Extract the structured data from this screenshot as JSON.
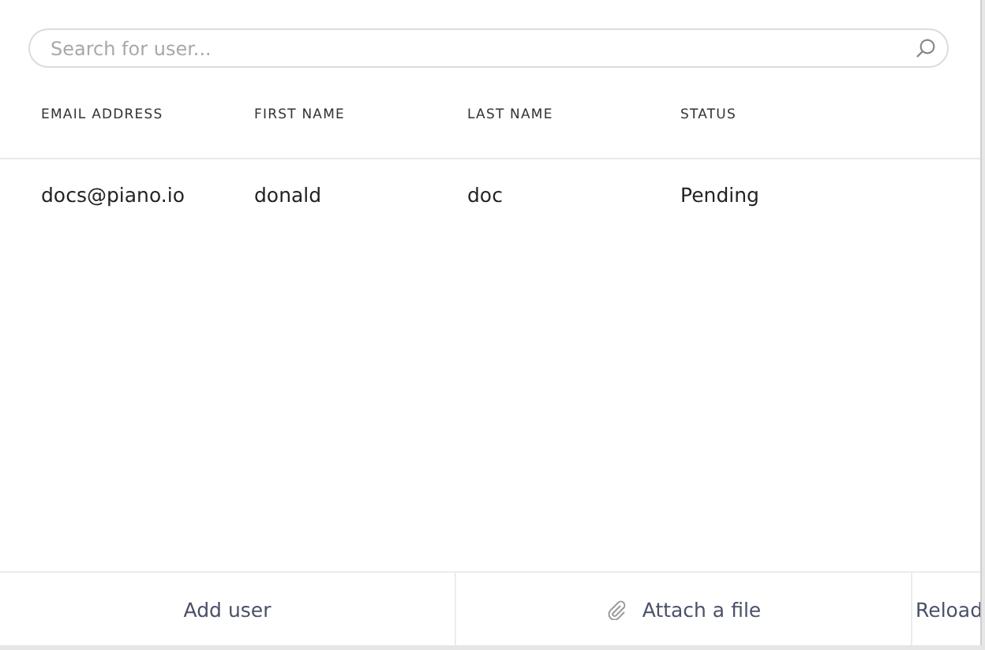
{
  "search": {
    "placeholder": "Search for user..."
  },
  "table": {
    "columns": [
      "EMAIL ADDRESS",
      "FIRST NAME",
      "LAST NAME",
      "STATUS"
    ],
    "rows": [
      [
        "docs@piano.io",
        "donald",
        "doc",
        "Pending"
      ]
    ]
  },
  "footer": {
    "buttons": [
      {
        "label": "Add user",
        "kind": "plain"
      },
      {
        "label": "Attach a file",
        "kind": "attach"
      },
      {
        "label": "Reload",
        "kind": "plain"
      }
    ]
  }
}
